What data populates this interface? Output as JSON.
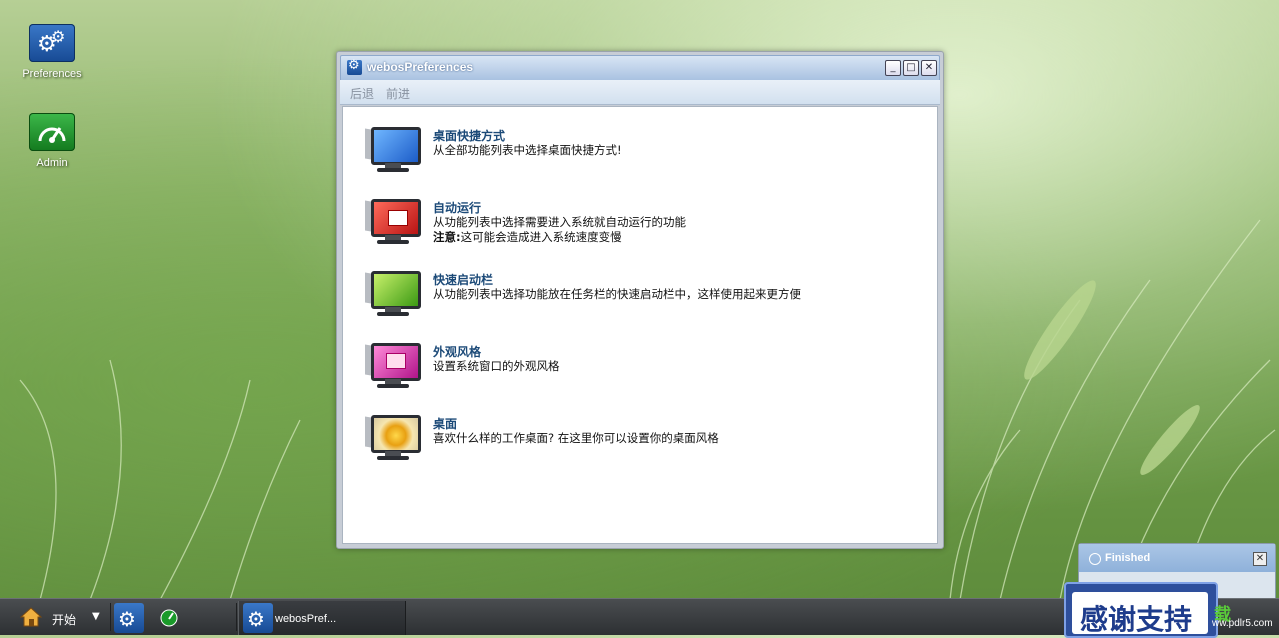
{
  "desktop": {
    "icons": [
      {
        "label": "Preferences",
        "icon": "gears-icon"
      },
      {
        "label": "Admin",
        "icon": "speedometer-icon"
      }
    ]
  },
  "window": {
    "title": "webosPreferences",
    "menu": {
      "back": "后退",
      "forward": "前进"
    },
    "items": [
      {
        "title": "桌面快捷方式",
        "desc": "从全部功能列表中选择桌面快捷方式!",
        "desc2": ""
      },
      {
        "title": "自动运行",
        "desc": "从功能列表中选择需要进入系统就自动运行的功能",
        "note_label": "注意:",
        "desc2": "这可能会造成进入系统速度变慢"
      },
      {
        "title": "快速启动栏",
        "desc": "从功能列表中选择功能放在任务栏的快速启动栏中，这样使用起来更方便",
        "desc2": ""
      },
      {
        "title": "外观风格",
        "desc": "设置系统窗口的外观风格",
        "desc2": ""
      },
      {
        "title": "桌面",
        "desc": "喜欢什么样的工作桌面? 在这里你可以设置你的桌面风格",
        "desc2": ""
      }
    ]
  },
  "notification": {
    "title": "Finished"
  },
  "taskbar": {
    "start_label": "开始",
    "task_label": "webosPref..."
  },
  "watermark": {
    "text": "感谢支持",
    "right_char": "载",
    "site": "ww.pdlr5.com"
  },
  "colors": {
    "title_blue": "#1c4a78",
    "taskbar": "#2d3033",
    "titlebar": "#a9c2e1"
  }
}
